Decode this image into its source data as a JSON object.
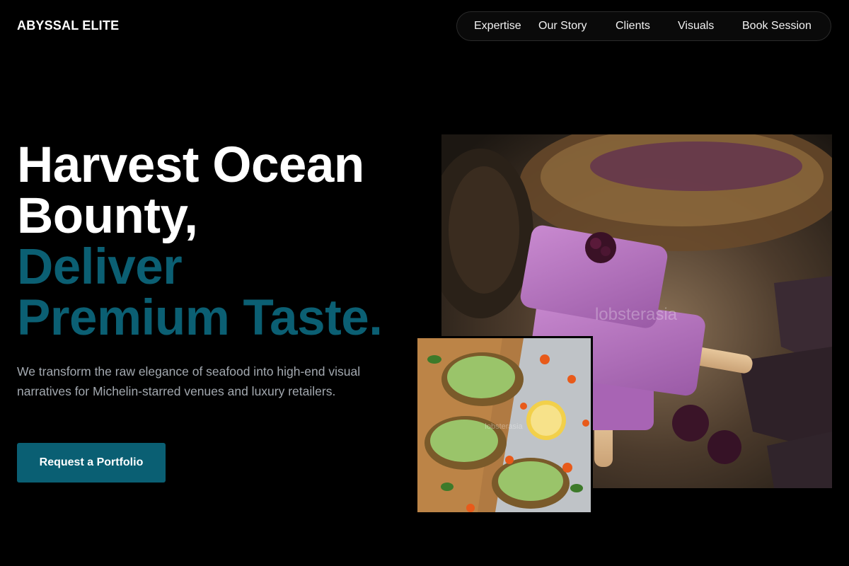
{
  "brand": {
    "name": "ABYSSAL ELITE"
  },
  "nav": {
    "items": [
      {
        "label": "Expertise"
      },
      {
        "label": "Our Story"
      },
      {
        "label": "Clients"
      },
      {
        "label": "Visuals"
      },
      {
        "label": "Book Session"
      }
    ]
  },
  "hero": {
    "title_lines": [
      "Harvest Ocean",
      "Bounty,"
    ],
    "title_accent_lines": [
      "Deliver",
      "Premium Taste."
    ],
    "description": "We transform the raw elegance of seafood into high-end visual narratives for Michelin-starred venues and luxury retailers.",
    "cta_label": "Request a Portfolio"
  },
  "images": {
    "main_photo_watermark": "lobsterasia",
    "small_photo_watermark": "lobsterasia"
  },
  "colors": {
    "background": "#000000",
    "accent_teal": "#0b5f73",
    "body_text": "#a3a9b0"
  }
}
